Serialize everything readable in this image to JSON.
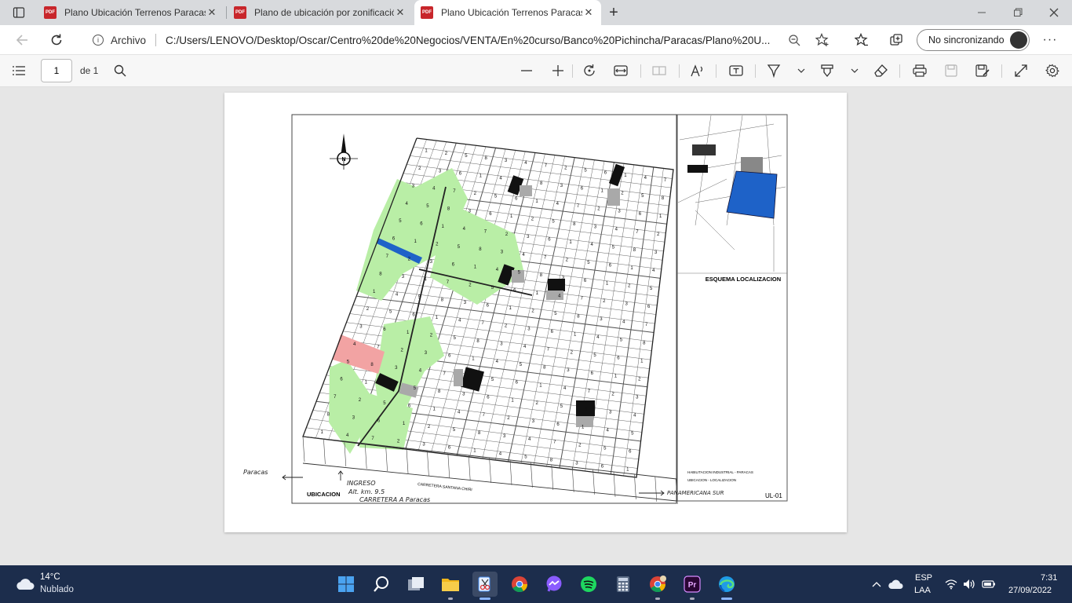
{
  "tabs": [
    {
      "title": "Plano Ubicación Terrenos Paracas",
      "icon": "pdf-icon",
      "close": "✕"
    },
    {
      "title": "Plano de ubicación por zonificación",
      "icon": "pdf-icon",
      "close": "✕"
    },
    {
      "title": "Plano Ubicación Terrenos Paracas",
      "icon": "pdf-icon",
      "close": "✕",
      "active": true
    }
  ],
  "new_tab": "+",
  "address_bar": {
    "protocol_label": "Archivo",
    "url": "C:/Users/LENOVO/Desktop/Oscar/Centro%20de%20Negocios/VENTA/En%20curso/Banco%20Pichincha/Paracas/Plano%20U..."
  },
  "profile_button": "No sincronizando",
  "pdf_toolbar": {
    "page_number": "1",
    "page_count": "de 1"
  },
  "map": {
    "title_block": "ESQUEMA LOCALIZACION",
    "sheet_code": "UL-01",
    "notes": [
      "HABILITACION INDUSTRIAL - PARACAS",
      "UBICACION - LOCALIZACION"
    ],
    "road_label": "CARRETERA SANTANA CHIRI",
    "ubicacion_label": "UBICACION",
    "handwriting": {
      "left_arrow": "Paracas",
      "entry": "INGRESO",
      "km": "Alt. km. 9.5",
      "road": "CARRETERA A Paracas",
      "right_arrow": "PANAMERICANA SUR"
    },
    "north": "N",
    "colors": {
      "green": "#b9eea6",
      "red": "#f2a3a3",
      "blue": "#1e62c8",
      "black": "#111111",
      "gray": "#a9a9a9"
    }
  },
  "taskbar": {
    "weather": {
      "temp": "14°C",
      "desc": "Nublado"
    },
    "language": [
      "ESP",
      "LAA"
    ],
    "time": "7:31",
    "date": "27/09/2022"
  }
}
